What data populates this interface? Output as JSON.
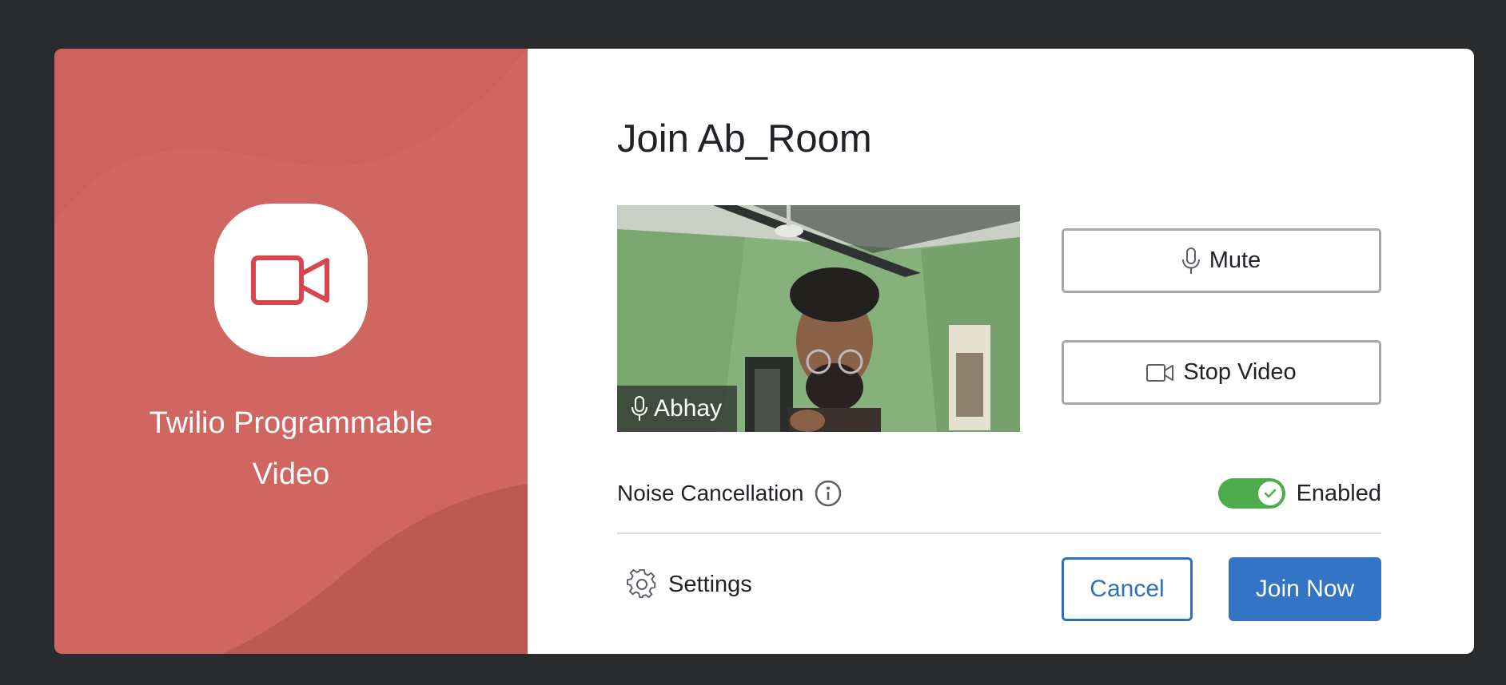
{
  "brand": {
    "name_line1": "Twilio Programmable",
    "name_line2": "Video",
    "logo_icon": "video-camera-icon",
    "panel_color": "#c25a56"
  },
  "dialog": {
    "title": "Join Ab_Room"
  },
  "preview": {
    "participant_name": "Abhay",
    "mic_icon": "microphone-icon"
  },
  "controls": {
    "mute_label": "Mute",
    "mute_icon": "microphone-icon",
    "stop_video_label": "Stop Video",
    "stop_video_icon": "video-camera-icon"
  },
  "noise_cancellation": {
    "label": "Noise Cancellation",
    "info_icon": "info-icon",
    "enabled": true,
    "state_label": "Enabled",
    "toggle_color": "#4cac4c"
  },
  "footer": {
    "settings_label": "Settings",
    "settings_icon": "gear-icon",
    "cancel_label": "Cancel",
    "join_label": "Join Now",
    "accent_color": "#3474c4"
  }
}
